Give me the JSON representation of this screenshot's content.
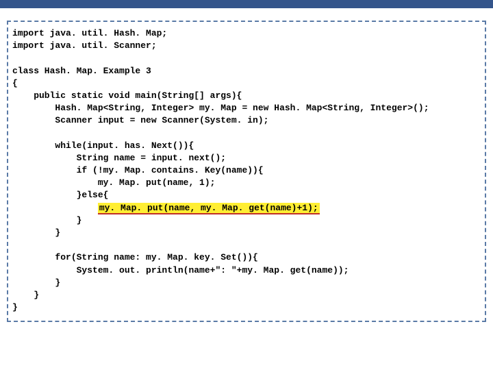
{
  "code": {
    "line1": "import java. util. Hash. Map;",
    "line2": "import java. util. Scanner;",
    "line3": "class Hash. Map. Example 3",
    "line4": "{",
    "line5": "    public static void main(String[] args){",
    "line6": "        Hash. Map<String, Integer> my. Map = new Hash. Map<String, Integer>();",
    "line7": "        Scanner input = new Scanner(System. in);",
    "line8": "        while(input. has. Next()){",
    "line9": "            String name = input. next();",
    "line10": "            if (!my. Map. contains. Key(name)){",
    "line11": "                my. Map. put(name, 1);",
    "line12": "            }else{",
    "line13_prefix": "                ",
    "line13_highlight": "my. Map. put(name, my. Map. get(name)+1);",
    "line14": "            }",
    "line15": "        }",
    "line16": "        for(String name: my. Map. key. Set()){",
    "line17": "            System. out. println(name+\": \"+my. Map. get(name));",
    "line18": "        }",
    "line19": "    }",
    "line20": "}"
  }
}
